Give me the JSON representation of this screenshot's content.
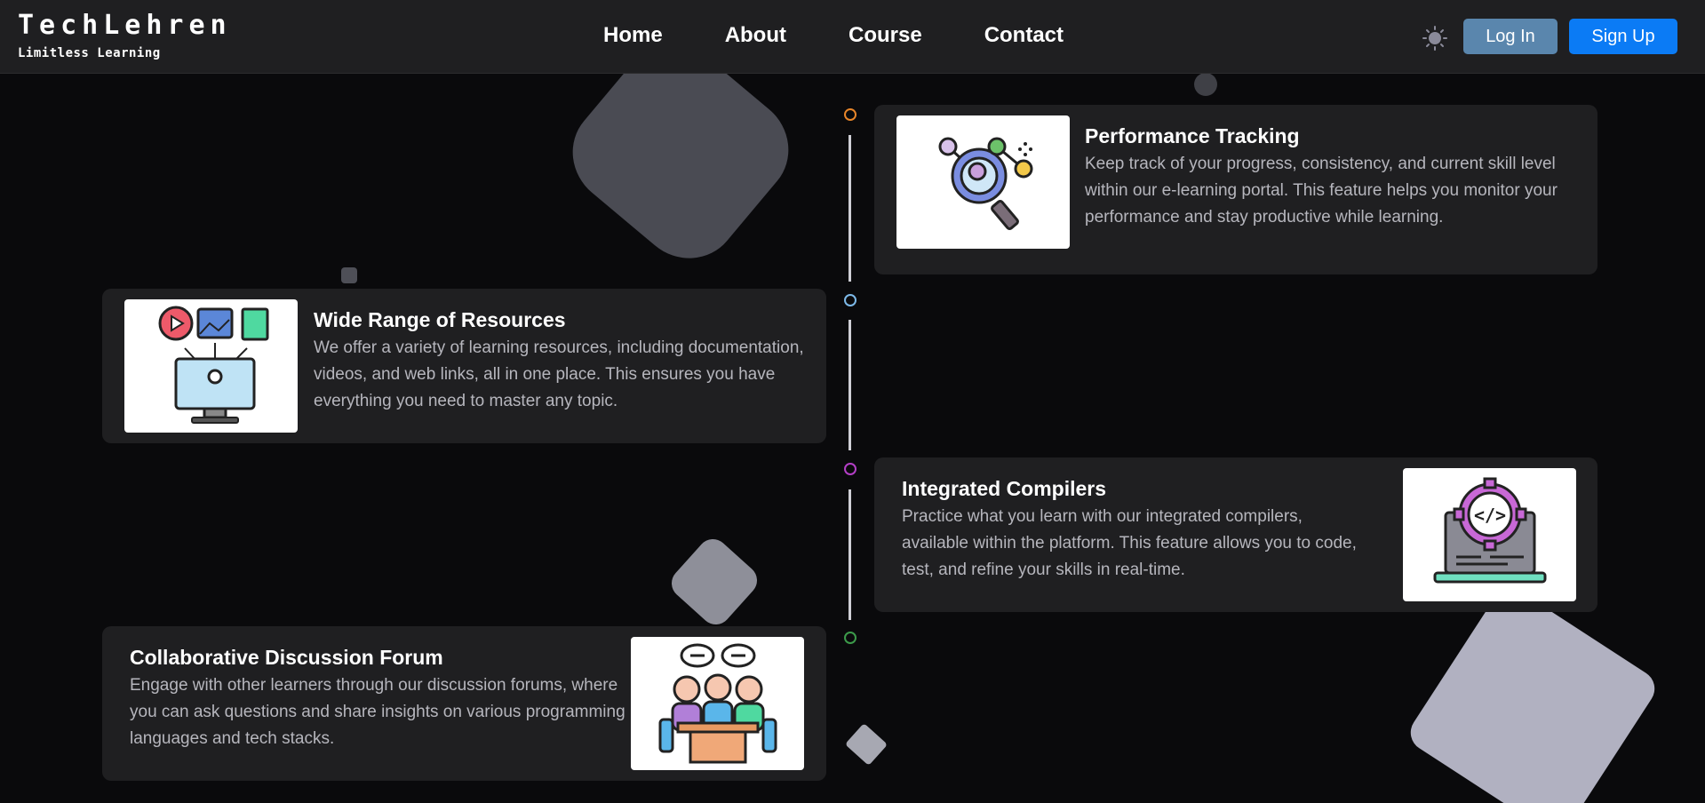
{
  "brand": {
    "title": "TechLehren",
    "tagline": "Limitless Learning"
  },
  "nav": {
    "home": "Home",
    "about": "About",
    "course": "Course",
    "contact": "Contact"
  },
  "auth": {
    "login": "Log In",
    "signup": "Sign Up"
  },
  "features": [
    {
      "title": "Performance Tracking",
      "description": "Keep track of your progress, consistency, and current skill level within our e-learning portal. This feature helps you monitor your performance and stay productive while learning.",
      "icon": "magnifier-analytics-icon",
      "dot_color": "#e8862a"
    },
    {
      "title": "Wide Range of Resources",
      "description": "We offer a variety of learning resources, including documentation, videos, and web links, all in one place. This ensures you have everything you need to master any topic.",
      "icon": "monitor-resources-icon",
      "dot_color": "#7db9e8"
    },
    {
      "title": "Integrated Compilers",
      "description": "Practice what you learn with our integrated compilers, available within the platform. This feature allows you to code, test, and refine your skills in real-time.",
      "icon": "laptop-code-gear-icon",
      "dot_color": "#b33fc6"
    },
    {
      "title": "Collaborative Discussion Forum",
      "description": "Engage with other learners through our discussion forums, where you can ask questions and share insights on various programming languages and tech stacks.",
      "icon": "group-discussion-icon",
      "dot_color": "#3c9a4a"
    }
  ],
  "colors": {
    "background": "#0a0a0c",
    "card": "#1f1f21",
    "accent": "#0b7bf5",
    "login": "#5a86ad"
  }
}
